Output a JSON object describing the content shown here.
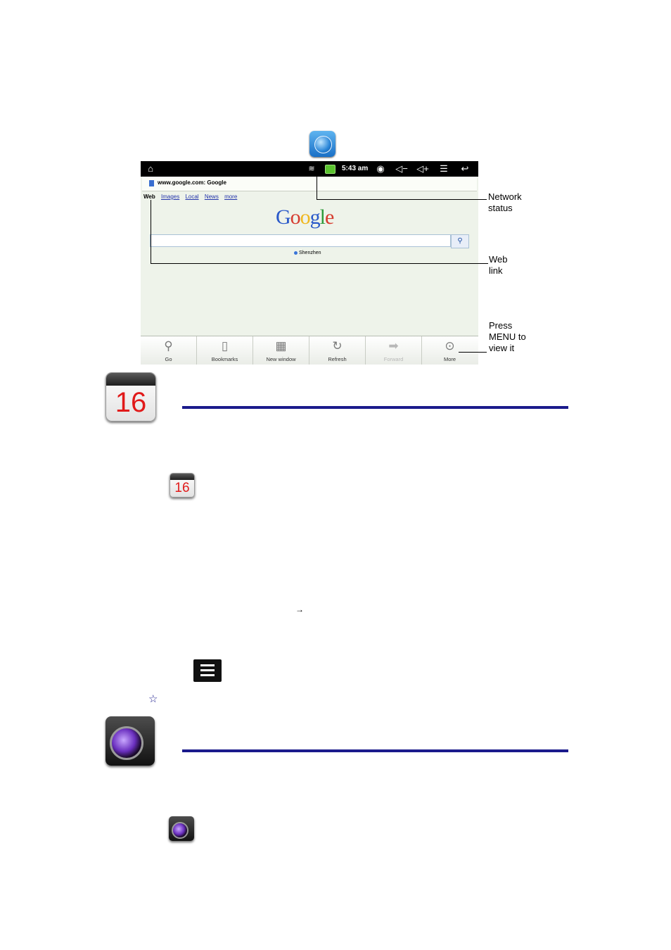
{
  "browser": {
    "statusbar": {
      "time": "5:43 am"
    },
    "url": "www.google.com: Google",
    "weblinks": [
      "Web",
      "Images",
      "Local",
      "News",
      "more"
    ],
    "logo": "Google",
    "location": "Shenzhen",
    "menu": [
      {
        "label": "Go",
        "icon": "search-icon"
      },
      {
        "label": "Bookmarks",
        "icon": "bookmark-icon"
      },
      {
        "label": "New window",
        "icon": "new-window-icon"
      },
      {
        "label": "Refresh",
        "icon": "refresh-icon"
      },
      {
        "label": "Forward",
        "icon": "forward-arrow-icon"
      },
      {
        "label": "More",
        "icon": "more-chevron-icon"
      }
    ]
  },
  "callouts": {
    "network": [
      "Network",
      "status"
    ],
    "weblink": [
      "Web",
      "link"
    ],
    "press": [
      "Press",
      "MENU to",
      "view it"
    ]
  },
  "calendar": {
    "day": "16"
  },
  "arrow_glyph": "→",
  "star_glyph": "☆",
  "colors": {
    "rule": "#1a1a8c",
    "statusbar": "#000000",
    "date_red": "#e11a1a"
  }
}
